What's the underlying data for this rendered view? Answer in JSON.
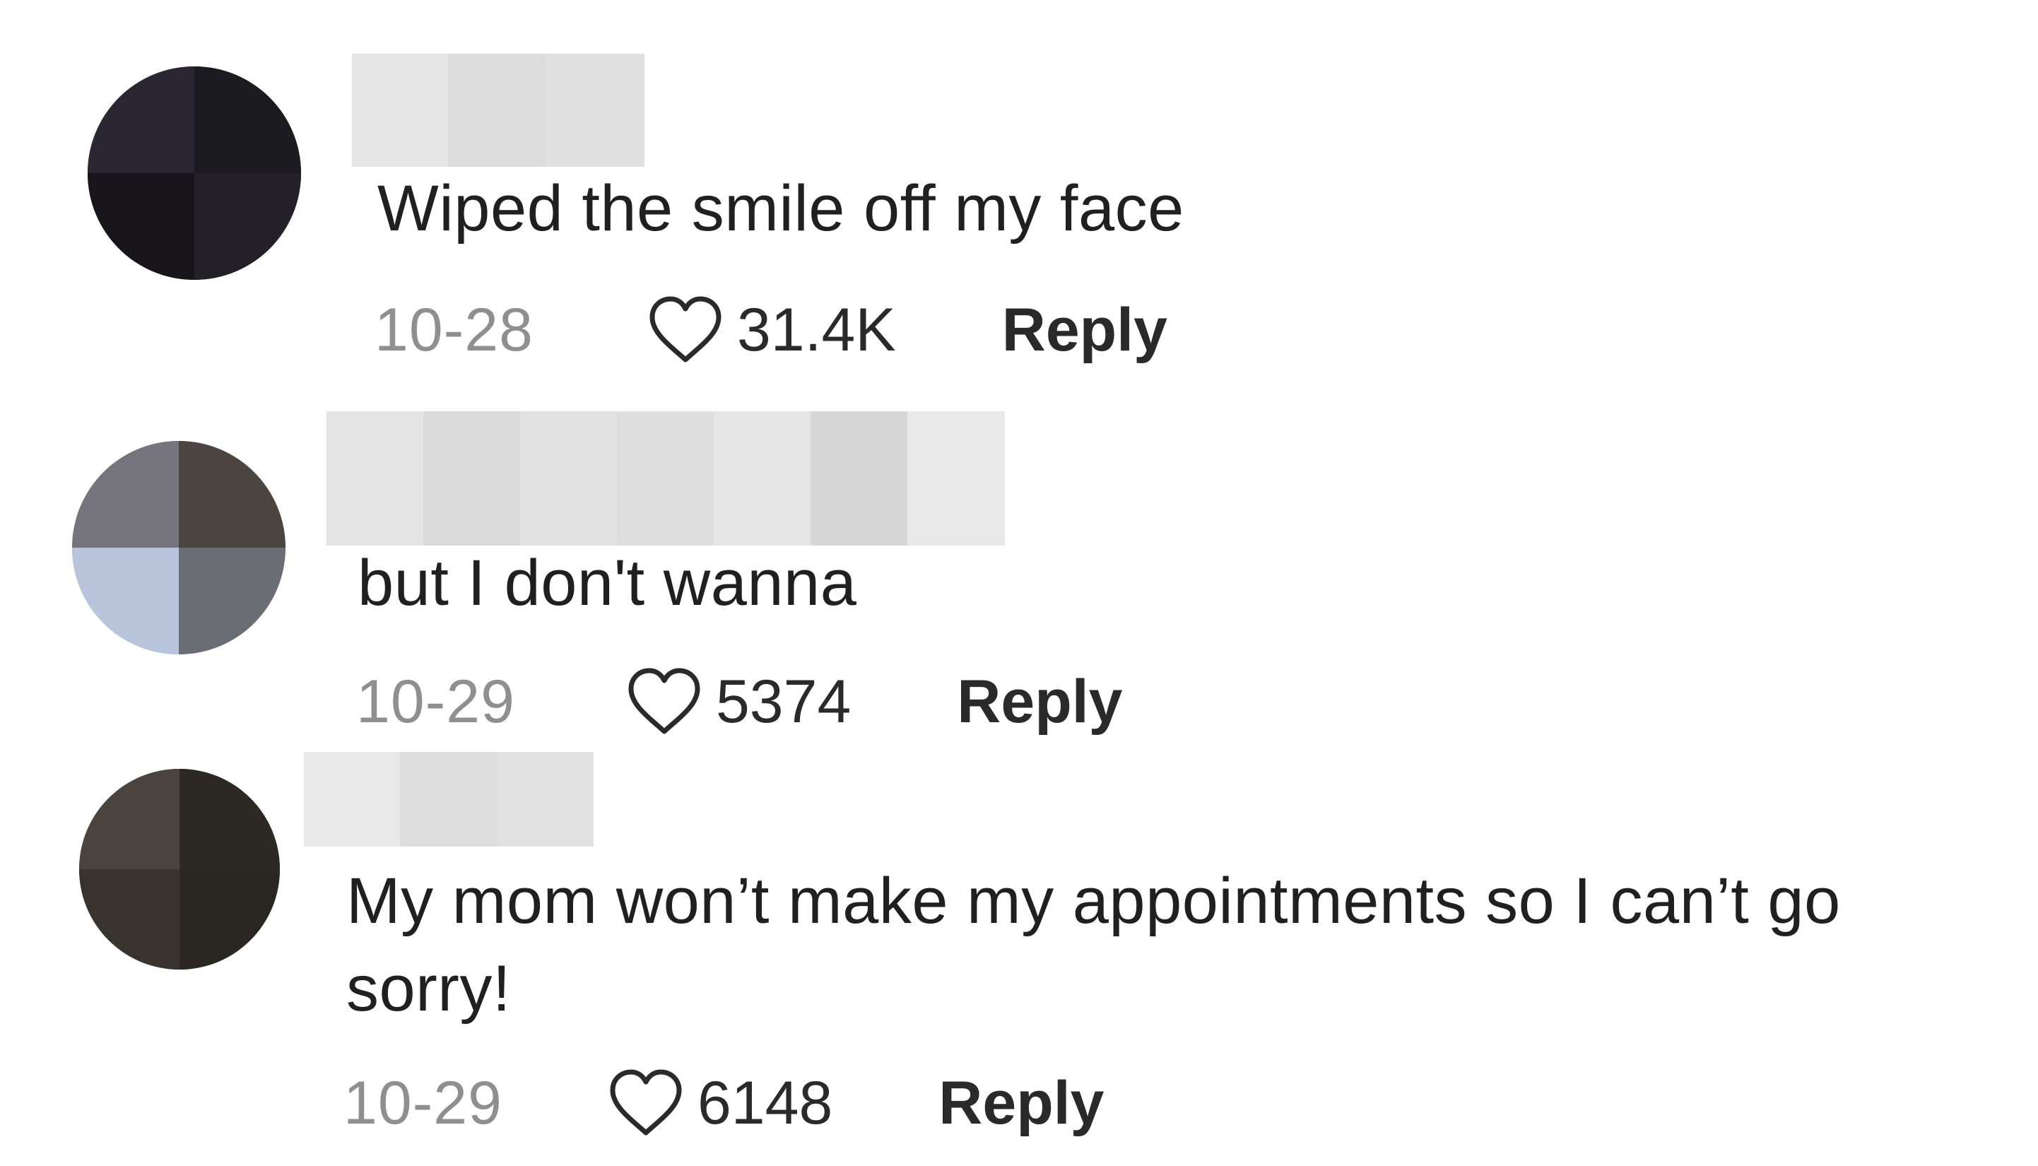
{
  "comments": [
    {
      "text_lines": [
        "Wiped the smile off my face"
      ],
      "date": "10-28",
      "likes": "31.4K",
      "reply_label": "Reply",
      "avatar_colors": [
        "#2a2733",
        "#1c1b20",
        "#18161a",
        "#232028"
      ],
      "username_colors": [
        "#e6e6e6",
        "#dcdcdc",
        "#e0e0e0"
      ]
    },
    {
      "text_lines": [
        "but I don't wanna"
      ],
      "date": "10-29",
      "likes": "5374",
      "reply_label": "Reply",
      "avatar_colors": [
        "#75737c",
        "#4c443f",
        "#b8c4dc",
        "#6a6d74"
      ],
      "username_colors": [
        "#e4e4e4",
        "#dadada",
        "#e2e2e2",
        "#dedede",
        "#e6e6e6",
        "#d6d6d6",
        "#e8e8e8"
      ]
    },
    {
      "text_lines": [
        "My mom won’t make my appointments so I can’t go",
        "sorry!"
      ],
      "date": "10-29",
      "likes": "6148",
      "reply_label": "Reply",
      "avatar_colors": [
        "#4a433e",
        "#2c2925",
        "#38332e",
        "#2a2622"
      ],
      "username_colors": [
        "#e8e8e8",
        "#dedede",
        "#e2e2e2"
      ]
    }
  ],
  "colors": {
    "text": "#202020",
    "date": "#8f8f8f",
    "heart_stroke": "#2a2a2a",
    "background": "#ffffff"
  },
  "icons": {
    "heart": "heart-outline-icon"
  }
}
